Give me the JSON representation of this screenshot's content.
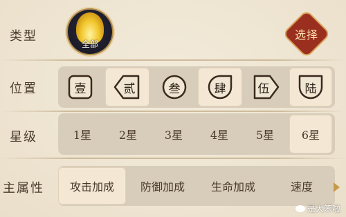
{
  "type_row": {
    "label": "类型",
    "emblem_tag": "全部",
    "select_button": "选择"
  },
  "position_row": {
    "label": "位置",
    "options": [
      {
        "label": "壹",
        "selected": false
      },
      {
        "label": "贰",
        "selected": true
      },
      {
        "label": "叁",
        "selected": false
      },
      {
        "label": "肆",
        "selected": true
      },
      {
        "label": "伍",
        "selected": false
      },
      {
        "label": "陆",
        "selected": true
      }
    ]
  },
  "star_row": {
    "label": "星级",
    "options": [
      {
        "label": "1星",
        "selected": false
      },
      {
        "label": "2星",
        "selected": false
      },
      {
        "label": "3星",
        "selected": false
      },
      {
        "label": "4星",
        "selected": false
      },
      {
        "label": "5星",
        "selected": false
      },
      {
        "label": "6星",
        "selected": true
      }
    ]
  },
  "attribute_row": {
    "label": "主属性",
    "options": [
      {
        "label": "攻击加成",
        "selected": true
      },
      {
        "label": "防御加成",
        "selected": false
      },
      {
        "label": "生命加成",
        "selected": false
      },
      {
        "label": "速度",
        "selected": false
      }
    ]
  },
  "watermark": "是大笨啦"
}
